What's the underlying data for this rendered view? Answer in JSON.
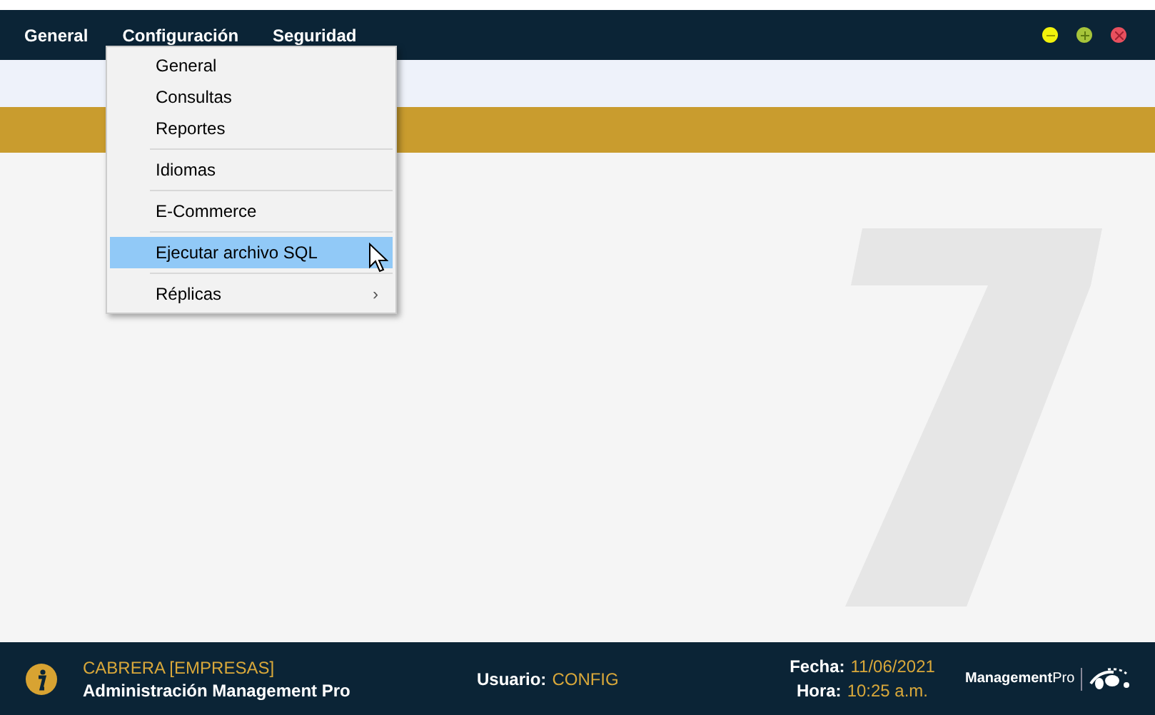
{
  "menu_bar": [
    {
      "label": "General"
    },
    {
      "label": "Configuración"
    },
    {
      "label": "Seguridad"
    }
  ],
  "window_controls": [
    {
      "kind": "minimize",
      "color": "#f2f20c"
    },
    {
      "kind": "maximize",
      "color": "#a6c43a"
    },
    {
      "kind": "close",
      "color": "#e8505e"
    }
  ],
  "dropdown_menu": {
    "groups": [
      [
        {
          "label": "General",
          "selected": false
        },
        {
          "label": "Consultas",
          "selected": false
        },
        {
          "label": "Reportes",
          "selected": false
        }
      ],
      [
        {
          "label": "Idiomas",
          "selected": false
        }
      ],
      [
        {
          "label": "E-Commerce",
          "selected": false
        }
      ],
      [
        {
          "label": "Ejecutar archivo SQL",
          "selected": true
        }
      ],
      [
        {
          "label": "Réplicas",
          "selected": false,
          "submenu_arrow": "›"
        }
      ]
    ]
  },
  "status_bar": {
    "company": "CABRERA [EMPRESAS]",
    "app_name": "Administración Management Pro",
    "user_label": "Usuario:",
    "user_value": "CONFIG",
    "date_label": "Fecha:",
    "date_value": "11/06/2021",
    "time_label": "Hora:",
    "time_value": "10:25 a.m.",
    "logo": "**Management**Pro"
  }
}
